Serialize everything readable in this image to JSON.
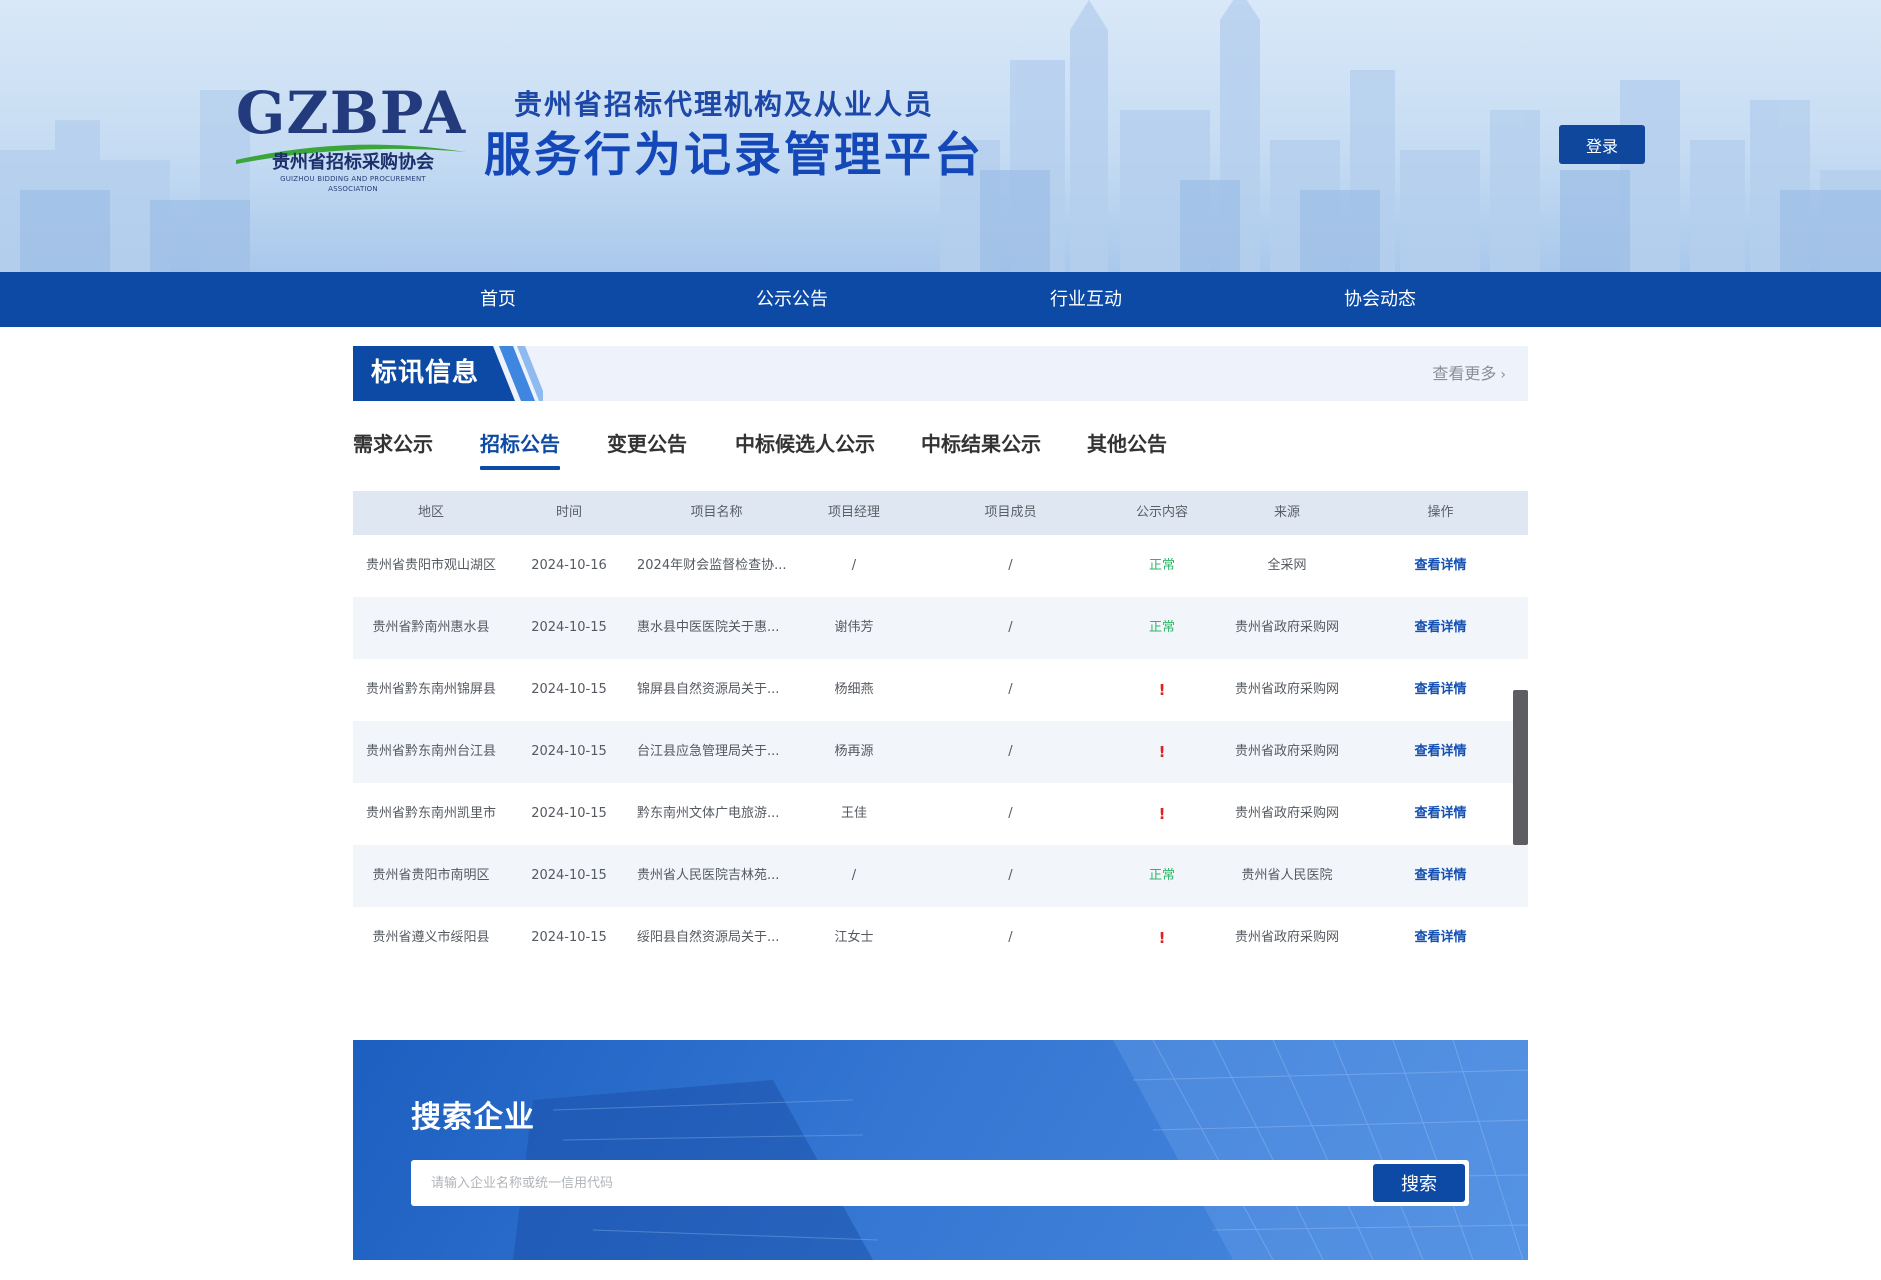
{
  "header": {
    "logo_text": "GZBPA",
    "logo_cn": "贵州省招标采购协会",
    "logo_en": "GUIZHOU BIDDING AND PROCUREMENT ASSOCIATION",
    "subtitle": "贵州省招标代理机构及从业人员",
    "title": "服务行为记录管理平台",
    "login_label": "登录"
  },
  "nav": {
    "items": [
      "首页",
      "公示公告",
      "行业互动",
      "协会动态"
    ]
  },
  "section": {
    "title": "标讯信息",
    "more_label": "查看更多"
  },
  "tabs": [
    {
      "label": "需求公示",
      "active": false
    },
    {
      "label": "招标公告",
      "active": true
    },
    {
      "label": "变更公告",
      "active": false
    },
    {
      "label": "中标候选人公示",
      "active": false
    },
    {
      "label": "中标结果公示",
      "active": false
    },
    {
      "label": "其他公告",
      "active": false
    }
  ],
  "table": {
    "columns": [
      "地区",
      "时间",
      "项目名称",
      "项目经理",
      "项目成员",
      "公示内容",
      "来源",
      "操作"
    ],
    "rows": [
      {
        "region": "贵州省贵阳市观山湖区",
        "date": "2024-10-16",
        "name": "2024年财会监督检查协...",
        "manager": "/",
        "members": "/",
        "content": "正常",
        "source": "全采网",
        "action": "查看详情"
      },
      {
        "region": "贵州省黔南州惠水县",
        "date": "2024-10-15",
        "name": "惠水县中医医院关于惠...",
        "manager": "谢伟芳",
        "members": "/",
        "content": "正常",
        "source": "贵州省政府采购网",
        "action": "查看详情"
      },
      {
        "region": "贵州省黔东南州锦屏县",
        "date": "2024-10-15",
        "name": "锦屏县自然资源局关于...",
        "manager": "杨细燕",
        "members": "/",
        "content": "!",
        "source": "贵州省政府采购网",
        "action": "查看详情"
      },
      {
        "region": "贵州省黔东南州台江县",
        "date": "2024-10-15",
        "name": "台江县应急管理局关于...",
        "manager": "杨再源",
        "members": "/",
        "content": "!",
        "source": "贵州省政府采购网",
        "action": "查看详情"
      },
      {
        "region": "贵州省黔东南州凯里市",
        "date": "2024-10-15",
        "name": "黔东南州文体广电旅游...",
        "manager": "王佳",
        "members": "/",
        "content": "!",
        "source": "贵州省政府采购网",
        "action": "查看详情"
      },
      {
        "region": "贵州省贵阳市南明区",
        "date": "2024-10-15",
        "name": "贵州省人民医院吉林苑...",
        "manager": "/",
        "members": "/",
        "content": "正常",
        "source": "贵州省人民医院",
        "action": "查看详情"
      },
      {
        "region": "贵州省遵义市绥阳县",
        "date": "2024-10-15",
        "name": "绥阳县自然资源局关于...",
        "manager": "江女士",
        "members": "/",
        "content": "!",
        "source": "贵州省政府采购网",
        "action": "查看详情"
      }
    ]
  },
  "search": {
    "title": "搜索企业",
    "placeholder": "请输入企业名称或统一信用代码",
    "button_label": "搜索"
  },
  "colors": {
    "primary": "#0d4aa5",
    "status_ok": "#2fb56a",
    "status_warn": "#e02020",
    "link": "#1450b3"
  },
  "icons": {
    "more": "chevron-right-icon"
  }
}
